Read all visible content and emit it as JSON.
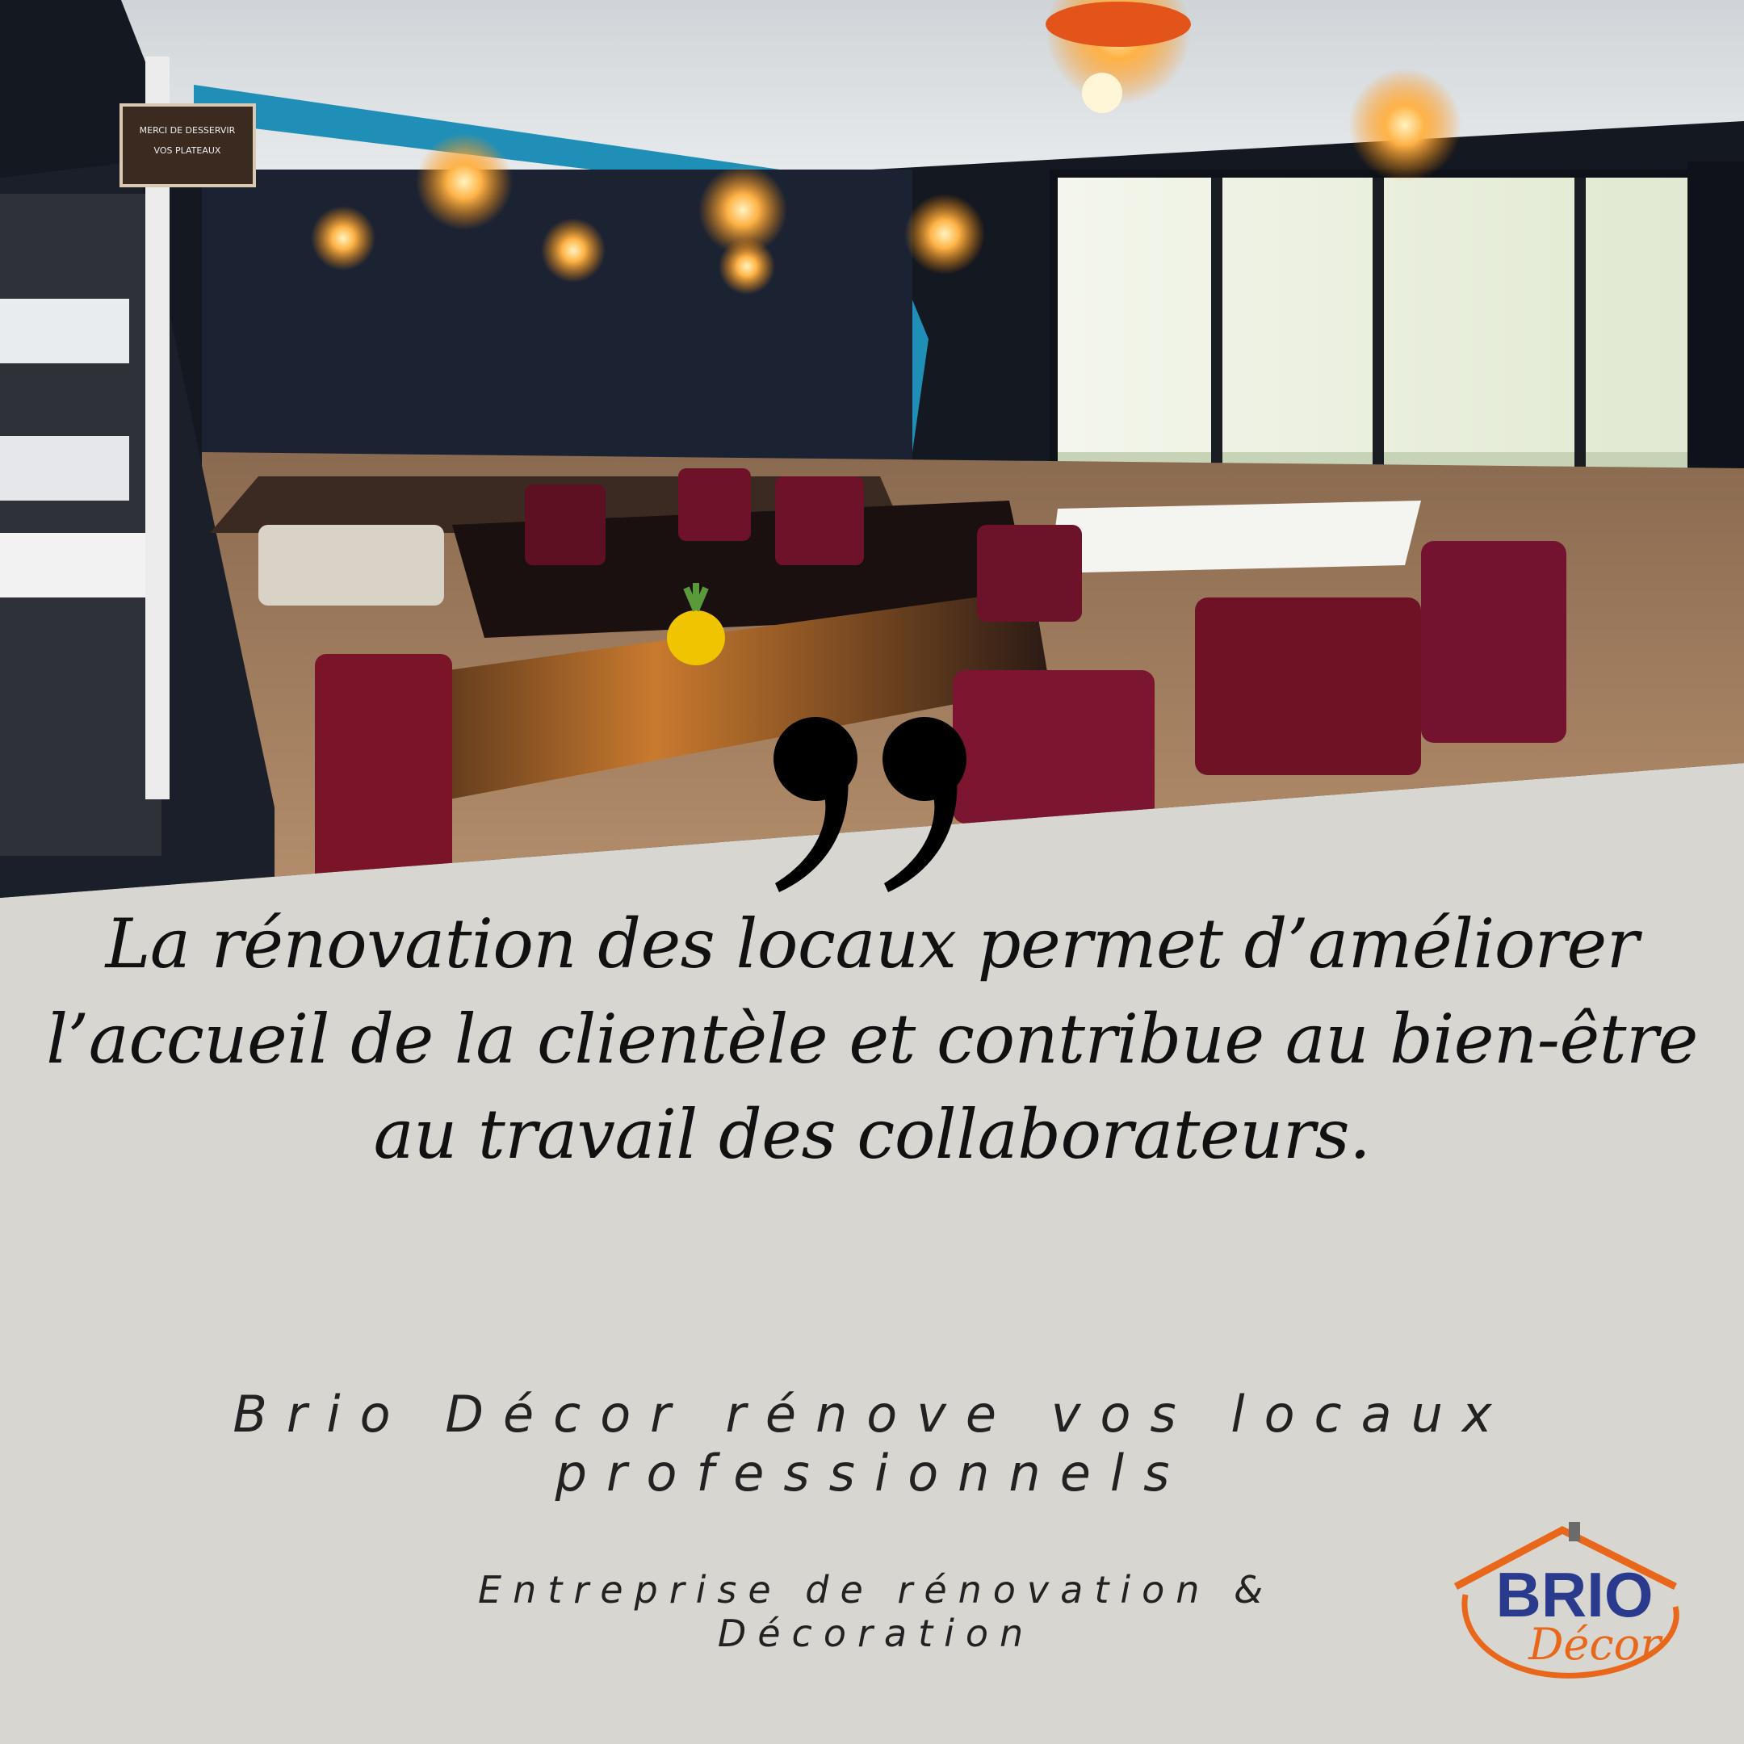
{
  "quote": {
    "text": "La rénovation des locaux permet d’améliorer l’accueil de la clientèle et contribue au bien-être au travail des collaborateurs."
  },
  "tagline": "Brio Décor rénove vos locaux professionnels",
  "subtagline": "Entreprise de rénovation & Décoration",
  "logo": {
    "word": "BRIO",
    "script": "Décor"
  },
  "sign_text": "MERCI DE DESSERVIR VOS PLATEAUX",
  "colors": {
    "background": "#d8d6d1",
    "logo_blue": "#2a3a8c",
    "logo_orange": "#e8671a"
  }
}
